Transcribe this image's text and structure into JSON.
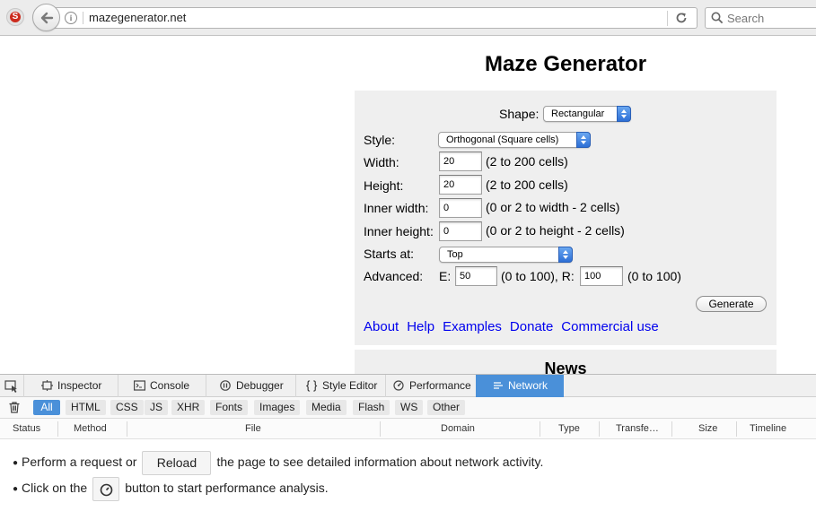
{
  "browser": {
    "url": "mazegenerator.net",
    "search_placeholder": "Search"
  },
  "page": {
    "title": "Maze Generator",
    "form": {
      "shape_label": "Shape:",
      "shape_value": "Rectangular",
      "style_label": "Style:",
      "style_value": "Orthogonal (Square cells)",
      "width_label": "Width:",
      "width_value": "20",
      "width_hint": "(2 to 200 cells)",
      "height_label": "Height:",
      "height_value": "20",
      "height_hint": "(2 to 200 cells)",
      "inner_width_label": "Inner width:",
      "inner_width_value": "0",
      "inner_width_hint": "(0 or 2 to width - 2 cells)",
      "inner_height_label": "Inner height:",
      "inner_height_value": "0",
      "inner_height_hint": "(0 or 2 to height - 2 cells)",
      "starts_at_label": "Starts at:",
      "starts_at_value": "Top",
      "advanced_label": "Advanced:",
      "e_label": "E:",
      "e_value": "50",
      "e_hint": "(0 to 100), R:",
      "r_value": "100",
      "r_hint": "(0 to 100)",
      "generate_label": "Generate"
    },
    "links": [
      "About",
      "Help",
      "Examples",
      "Donate",
      "Commercial use"
    ],
    "news_title": "News"
  },
  "devtools": {
    "tabs": [
      "Inspector",
      "Console",
      "Debugger",
      "Style Editor",
      "Performance",
      "Network"
    ],
    "active_tab": "Network",
    "filters": [
      "All",
      "HTML",
      "CSS",
      "JS",
      "XHR",
      "Fonts",
      "Images",
      "Media",
      "Flash",
      "WS",
      "Other"
    ],
    "active_filter": "All",
    "columns": [
      "Status",
      "Method",
      "File",
      "Domain",
      "Type",
      "Transfe…",
      "Size",
      "Timeline"
    ],
    "empty": {
      "line1_before": "Perform a request or",
      "reload_label": "Reload",
      "line1_after": "the page to see detailed information about network activity.",
      "line2_before": "Click on the",
      "line2_after": "button to start performance analysis."
    },
    "accent_color": "#4a90d9"
  }
}
